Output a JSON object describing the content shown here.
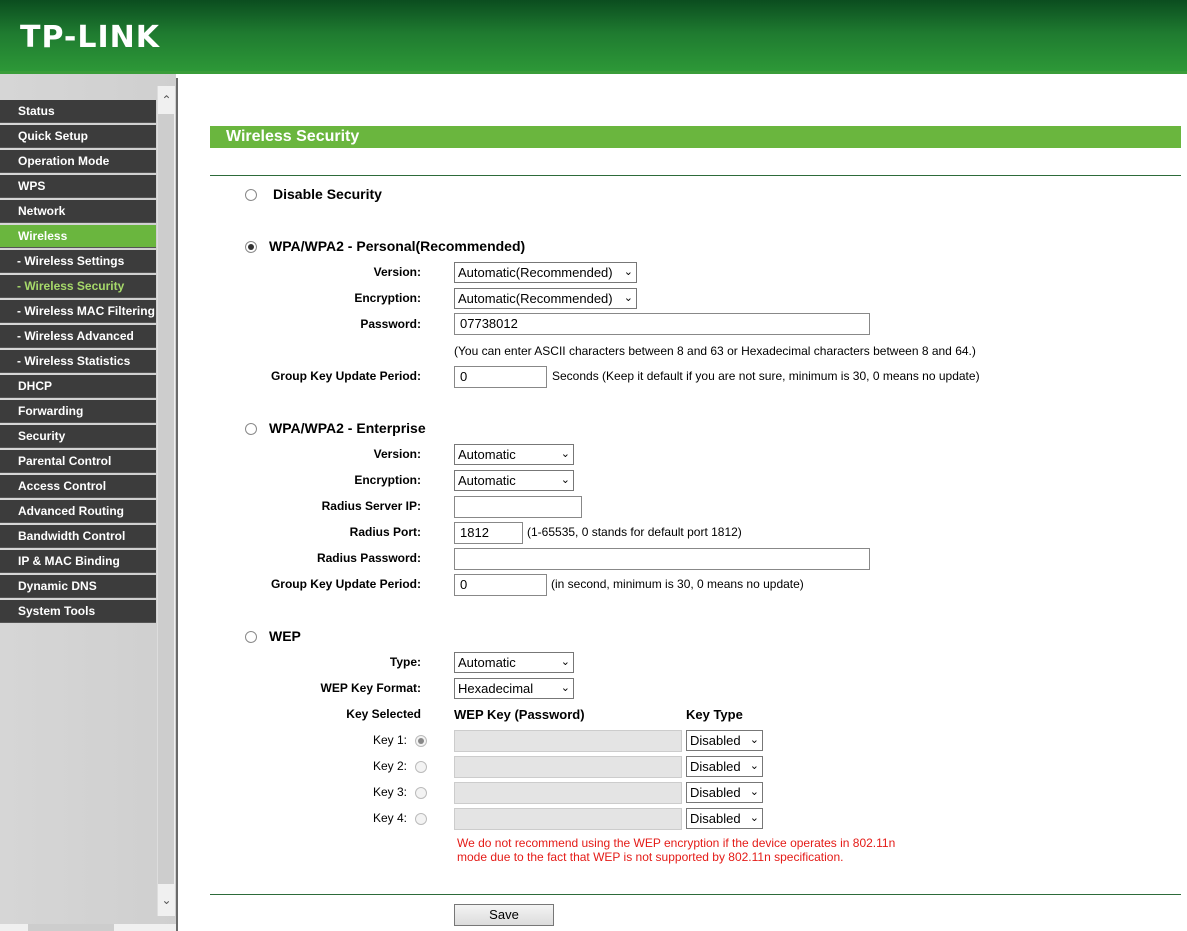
{
  "brand": {
    "logo": "TP-LINK",
    "trademark": "®"
  },
  "sidebar": {
    "items": [
      {
        "label": "Status"
      },
      {
        "label": "Quick Setup"
      },
      {
        "label": "Operation Mode"
      },
      {
        "label": "WPS"
      },
      {
        "label": "Network"
      },
      {
        "label": "Wireless"
      },
      {
        "label": "- Wireless Settings"
      },
      {
        "label": "- Wireless Security"
      },
      {
        "label": "- Wireless MAC Filtering"
      },
      {
        "label": "- Wireless Advanced"
      },
      {
        "label": "- Wireless Statistics"
      },
      {
        "label": "DHCP"
      },
      {
        "label": "Forwarding"
      },
      {
        "label": "Security"
      },
      {
        "label": "Parental Control"
      },
      {
        "label": "Access Control"
      },
      {
        "label": "Advanced Routing"
      },
      {
        "label": "Bandwidth Control"
      },
      {
        "label": "IP & MAC Binding"
      },
      {
        "label": "Dynamic DNS"
      },
      {
        "label": "System Tools"
      }
    ],
    "active": "Wireless",
    "current": "- Wireless Security"
  },
  "page": {
    "title": "Wireless Security"
  },
  "disable": {
    "label": "Disable Security",
    "selected": false
  },
  "personal": {
    "label": "WPA/WPA2 - Personal(Recommended)",
    "selected": true,
    "version_label": "Version:",
    "version_value": "Automatic(Recommended)",
    "encryption_label": "Encryption:",
    "encryption_value": "Automatic(Recommended)",
    "password_label": "Password:",
    "password_value": "07738012",
    "password_hint": "(You can enter ASCII characters between 8 and 63 or Hexadecimal characters between 8 and 64.)",
    "group_label": "Group Key Update Period:",
    "group_value": "0",
    "group_hint": "Seconds (Keep it default if you are not sure, minimum is 30, 0 means no update)"
  },
  "enterprise": {
    "label": "WPA/WPA2 - Enterprise",
    "selected": false,
    "version_label": "Version:",
    "version_value": "Automatic",
    "encryption_label": "Encryption:",
    "encryption_value": "Automatic",
    "radius_ip_label": "Radius Server IP:",
    "radius_ip_value": "",
    "radius_port_label": "Radius Port:",
    "radius_port_value": "1812",
    "radius_port_hint": "(1-65535, 0 stands for default port 1812)",
    "radius_password_label": "Radius Password:",
    "radius_password_value": "",
    "group_label": "Group Key Update Period:",
    "group_value": "0",
    "group_hint": "(in second, minimum is 30, 0 means no update)"
  },
  "wep": {
    "label": "WEP",
    "selected": false,
    "type_label": "Type:",
    "type_value": "Automatic",
    "format_label": "WEP Key Format:",
    "format_value": "Hexadecimal",
    "col_selected": "Key Selected",
    "col_key": "WEP Key (Password)",
    "col_type": "Key Type",
    "keys": [
      {
        "label": "Key 1:",
        "selected": true,
        "type": "Disabled",
        "value": ""
      },
      {
        "label": "Key 2:",
        "selected": false,
        "type": "Disabled",
        "value": ""
      },
      {
        "label": "Key 3:",
        "selected": false,
        "type": "Disabled",
        "value": ""
      },
      {
        "label": "Key 4:",
        "selected": false,
        "type": "Disabled",
        "value": ""
      }
    ],
    "warning": "We do not recommend using the WEP encryption if the device operates in 802.11n mode due to the fact that WEP is not supported by 802.11n specification."
  },
  "save_label": "Save",
  "icons": {
    "scroll_up": "chevron-up-icon",
    "scroll_down": "chevron-down-icon",
    "dropdown": "chevron-down-icon"
  }
}
